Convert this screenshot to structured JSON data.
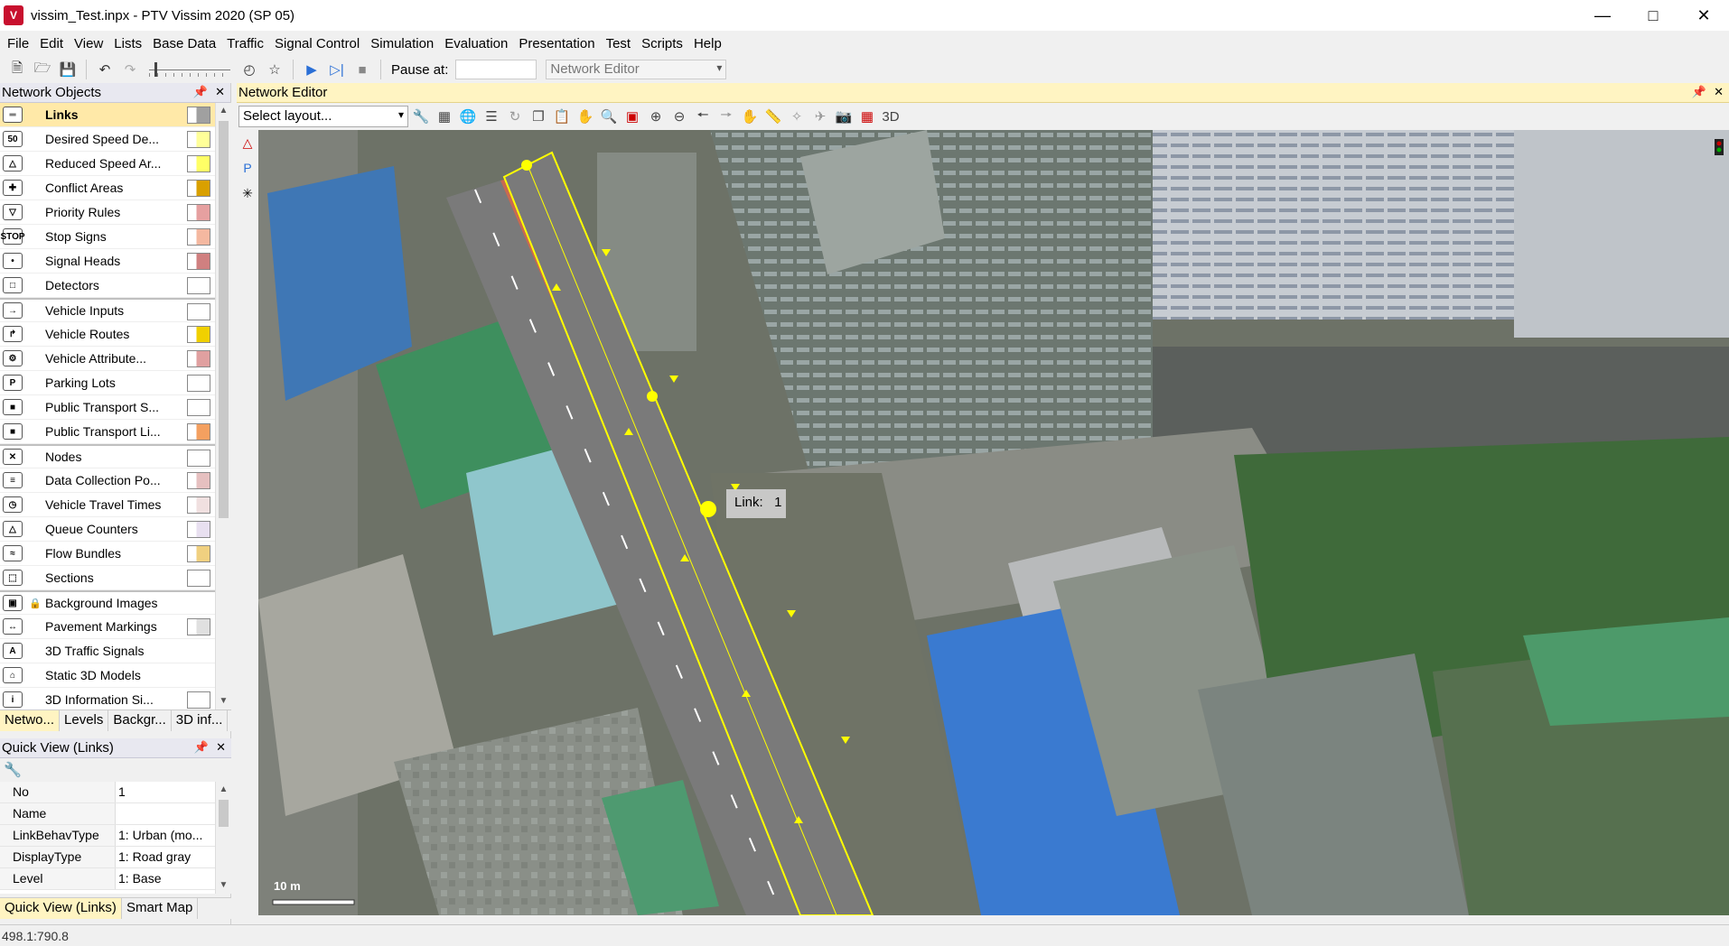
{
  "window": {
    "title": "vissim_Test.inpx - PTV Vissim 2020 (SP 05)",
    "app_icon_text": "V",
    "minimize": "—",
    "maximize": "□",
    "close": "✕"
  },
  "menu": [
    "File",
    "Edit",
    "View",
    "Lists",
    "Base Data",
    "Traffic",
    "Signal Control",
    "Simulation",
    "Evaluation",
    "Presentation",
    "Test",
    "Scripts",
    "Help"
  ],
  "toolbar": {
    "pause_label": "Pause at:",
    "pause_value": "",
    "editor_combo": "Network Editor"
  },
  "network_objects": {
    "title": "Network Objects",
    "items": [
      {
        "label": "Links",
        "icon": "links-icon",
        "glyph": "═",
        "swatch": "#a0a0a0",
        "group_start": false,
        "selected": true
      },
      {
        "label": "Desired Speed De...",
        "icon": "speed-limit-icon",
        "glyph": "50",
        "swatch": "#ffff99",
        "group_start": false,
        "selected": false
      },
      {
        "label": "Reduced Speed Ar...",
        "icon": "reduced-speed-icon",
        "glyph": "△",
        "swatch": "#ffff66",
        "group_start": false,
        "selected": false
      },
      {
        "label": "Conflict Areas",
        "icon": "conflict-areas-icon",
        "glyph": "✚",
        "swatch": "#d9a000",
        "group_start": false,
        "selected": false
      },
      {
        "label": "Priority Rules",
        "icon": "priority-rules-icon",
        "glyph": "▽",
        "swatch": "#e6a0a0",
        "group_start": false,
        "selected": false
      },
      {
        "label": "Stop Signs",
        "icon": "stop-sign-icon",
        "glyph": "STOP",
        "swatch": "#f4b8a0",
        "group_start": false,
        "selected": false
      },
      {
        "label": "Signal Heads",
        "icon": "signal-head-icon",
        "glyph": "•",
        "swatch": "#d08080",
        "group_start": false,
        "selected": false
      },
      {
        "label": "Detectors",
        "icon": "detector-icon",
        "glyph": "□",
        "swatch": "#ffffff",
        "group_start": false,
        "selected": false
      },
      {
        "label": "Vehicle Inputs",
        "icon": "vehicle-input-icon",
        "glyph": "→",
        "swatch": "#ffffff",
        "group_start": true,
        "selected": false
      },
      {
        "label": "Vehicle Routes",
        "icon": "vehicle-route-icon",
        "glyph": "↱",
        "swatch": "#f0d000",
        "group_start": false,
        "selected": false
      },
      {
        "label": "Vehicle Attribute...",
        "icon": "vehicle-attribute-icon",
        "glyph": "⚙",
        "swatch": "#e0a0a0",
        "group_start": false,
        "selected": false
      },
      {
        "label": "Parking Lots",
        "icon": "parking-lot-icon",
        "glyph": "P",
        "swatch": "#ffffff",
        "group_start": false,
        "selected": false
      },
      {
        "label": "Public Transport S...",
        "icon": "pt-stop-icon",
        "glyph": "■",
        "swatch": "#ffffff",
        "group_start": false,
        "selected": false
      },
      {
        "label": "Public Transport Li...",
        "icon": "pt-line-icon",
        "glyph": "■",
        "swatch": "#f4a060",
        "group_start": false,
        "selected": false
      },
      {
        "label": "Nodes",
        "icon": "nodes-icon",
        "glyph": "✕",
        "swatch": "#ffffff",
        "group_start": true,
        "selected": false
      },
      {
        "label": "Data Collection Po...",
        "icon": "data-collection-icon",
        "glyph": "≡",
        "swatch": "#e6c0c0",
        "group_start": false,
        "selected": false
      },
      {
        "label": "Vehicle Travel Times",
        "icon": "travel-time-icon",
        "glyph": "◷",
        "swatch": "#f0e0e0",
        "group_start": false,
        "selected": false
      },
      {
        "label": "Queue Counters",
        "icon": "queue-counter-icon",
        "glyph": "△",
        "swatch": "#e8e0f0",
        "group_start": false,
        "selected": false
      },
      {
        "label": "Flow Bundles",
        "icon": "flow-bundle-icon",
        "glyph": "≈",
        "swatch": "#f0d080",
        "group_start": false,
        "selected": false
      },
      {
        "label": "Sections",
        "icon": "sections-icon",
        "glyph": "⬚",
        "swatch": "#ffffff",
        "group_start": false,
        "selected": false
      },
      {
        "label": "Background Images",
        "icon": "background-image-icon",
        "glyph": "▣",
        "swatch": "",
        "group_start": true,
        "selected": false,
        "locked": true
      },
      {
        "label": "Pavement Markings",
        "icon": "pavement-marking-icon",
        "glyph": "↔",
        "swatch": "#e0e0e0",
        "group_start": false,
        "selected": false
      },
      {
        "label": "3D Traffic Signals",
        "icon": "3d-signal-icon",
        "glyph": "A",
        "swatch": "",
        "group_start": false,
        "selected": false
      },
      {
        "label": "Static 3D Models",
        "icon": "static-3d-model-icon",
        "glyph": "⌂",
        "swatch": "",
        "group_start": false,
        "selected": false
      },
      {
        "label": "3D Information Si...",
        "icon": "3d-info-sign-icon",
        "glyph": "i",
        "swatch": "#ffffff",
        "group_start": false,
        "selected": false
      }
    ]
  },
  "left_tabs": [
    "Netwo...",
    "Levels",
    "Backgr...",
    "3D inf..."
  ],
  "quick_view": {
    "title": "Quick View (Links)",
    "rows": [
      {
        "key": "No",
        "value": "1"
      },
      {
        "key": "Name",
        "value": ""
      },
      {
        "key": "LinkBehavType",
        "value": "1: Urban (mo..."
      },
      {
        "key": "DisplayType",
        "value": "1: Road gray"
      },
      {
        "key": "Level",
        "value": "1: Base"
      }
    ],
    "tabs": [
      "Quick View (Links)",
      "Smart Map"
    ]
  },
  "editor": {
    "title": "Network Editor",
    "layout_placeholder": "Select layout...",
    "link_tooltip": "Link:   1",
    "scale_label": "10 m"
  },
  "status": {
    "coordinates": "498.1:790.8"
  },
  "colors": {
    "selection_yellow": "#ffff00",
    "road_gray": "#7a7a7a",
    "panel_header": "#fff4c2"
  }
}
